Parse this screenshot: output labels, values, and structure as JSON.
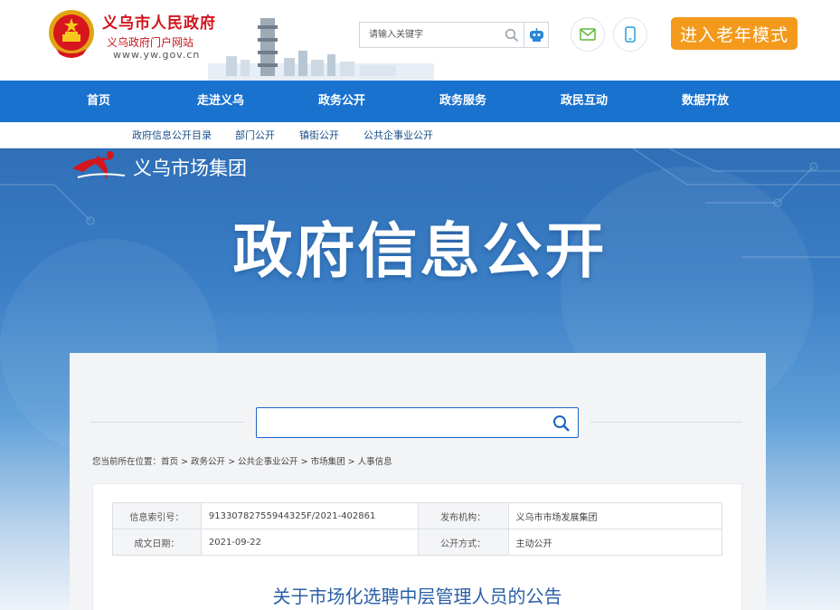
{
  "header": {
    "site_title": "义乌市人民政府",
    "site_subtitle": "义乌政府门户网站",
    "site_url": "www.yw.gov.cn",
    "search_placeholder": "请输入关键字",
    "elder_mode_label": "进入老年模式"
  },
  "mainnav": {
    "items": [
      {
        "label": "首页"
      },
      {
        "label": "走进义乌"
      },
      {
        "label": "政务公开"
      },
      {
        "label": "政务服务"
      },
      {
        "label": "政民互动"
      },
      {
        "label": "数据开放"
      }
    ]
  },
  "subnav": {
    "items": [
      {
        "label": "政府信息公开目录"
      },
      {
        "label": "部门公开"
      },
      {
        "label": "镇街公开"
      },
      {
        "label": "公共企事业公开"
      }
    ]
  },
  "banner": {
    "group_name": "义乌市场集团",
    "title": "政府信息公开"
  },
  "breadcrumb": {
    "prefix": "您当前所在位置：",
    "items": [
      "首页",
      "政务公开",
      "公共企事业公开",
      "市场集团",
      "人事信息"
    ],
    "separator": " > "
  },
  "meta": {
    "index_label": "信息索引号：",
    "index_value": "91330782755944325F/2021-402861",
    "publisher_label": "发布机构：",
    "publisher_value": "义乌市市场发展集团",
    "date_label": "成文日期：",
    "date_value": "2021-09-22",
    "method_label": "公开方式：",
    "method_value": "主动公开"
  },
  "document": {
    "title": "关于市场化选聘中层管理人员的公告"
  },
  "colors": {
    "nav_blue": "#1a72cf",
    "brand_red": "#d3141c",
    "elder_orange": "#f39a1d",
    "title_blue": "#2a5fa8"
  }
}
